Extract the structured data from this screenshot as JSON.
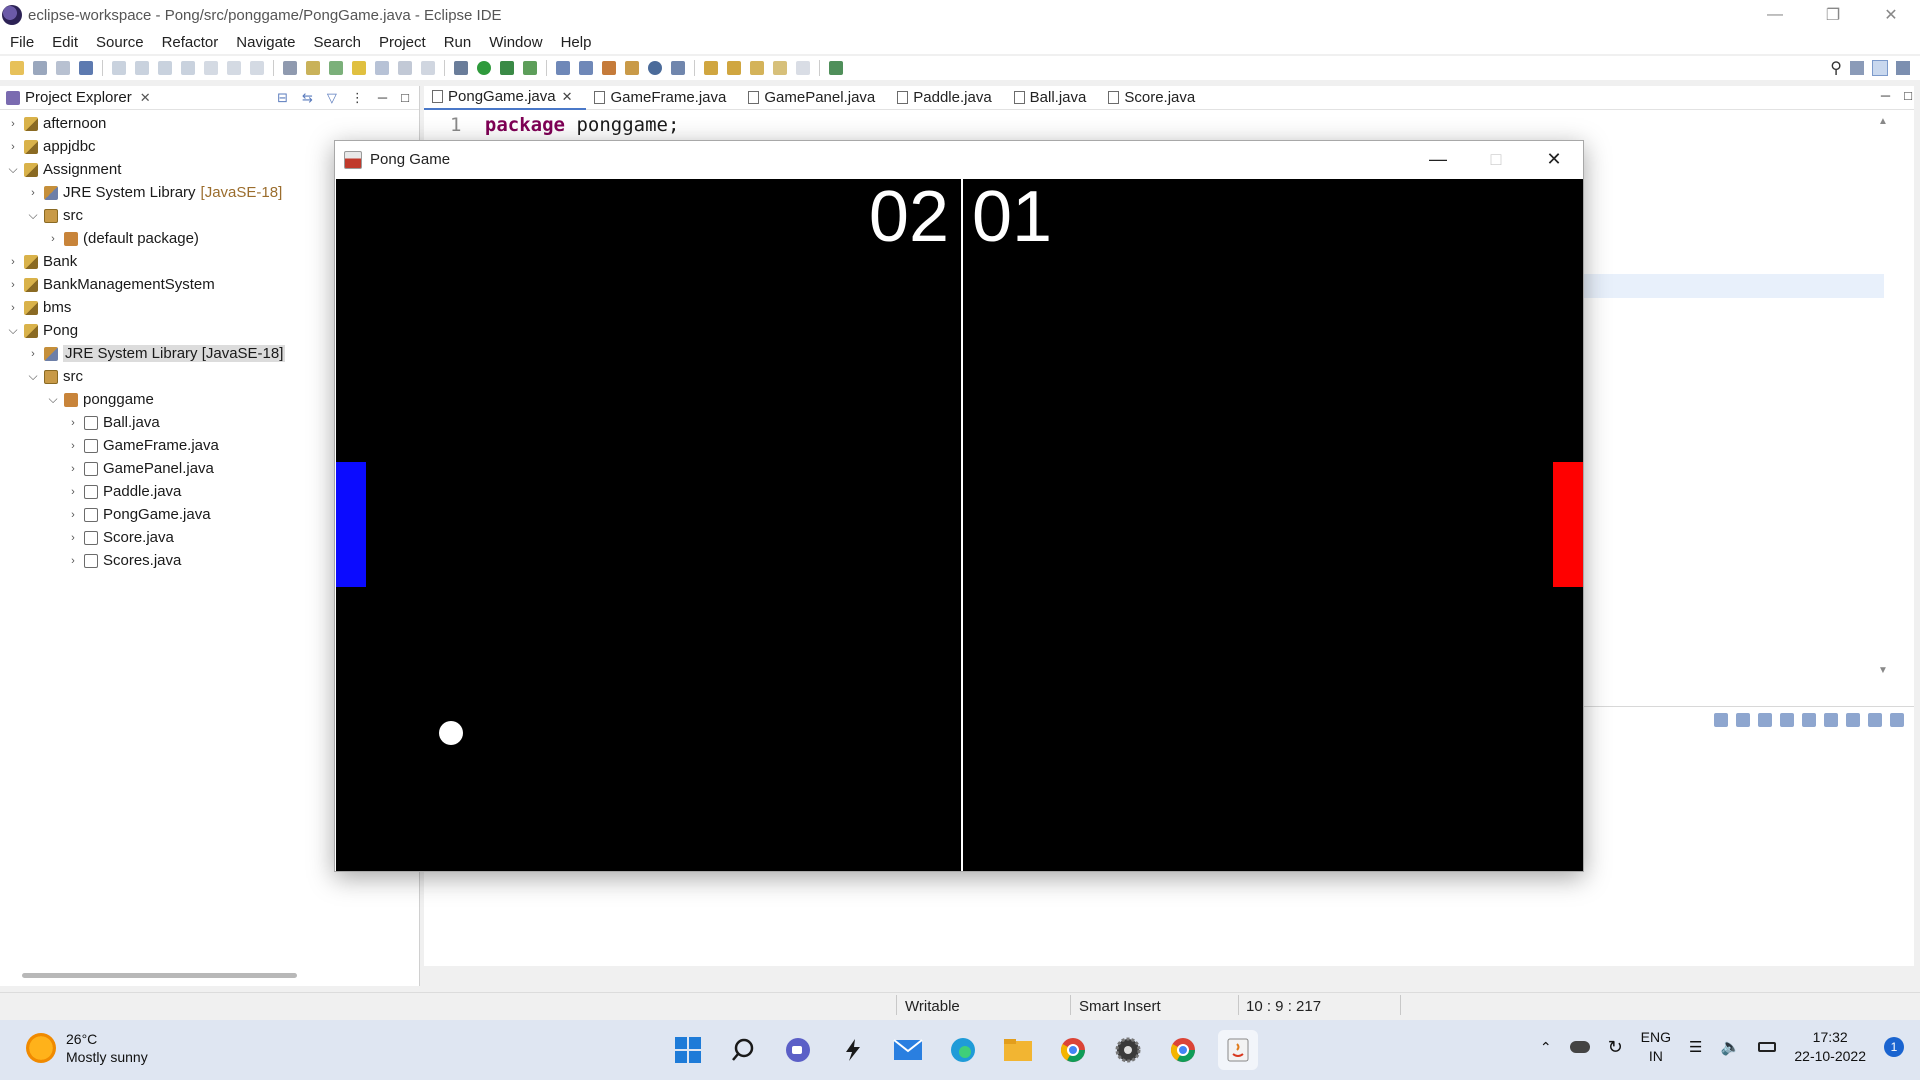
{
  "window": {
    "title": "eclipse-workspace - Pong/src/ponggame/PongGame.java - Eclipse IDE"
  },
  "menu": [
    "File",
    "Edit",
    "Source",
    "Refactor",
    "Navigate",
    "Search",
    "Project",
    "Run",
    "Window",
    "Help"
  ],
  "explorer": {
    "title": "Project Explorer",
    "tree": [
      {
        "label": "afternoon",
        "extra": "",
        "depth": 0,
        "expanded": false,
        "icon": "project-icon"
      },
      {
        "label": "appjdbc",
        "extra": "",
        "depth": 0,
        "expanded": false,
        "icon": "project-icon"
      },
      {
        "label": "Assignment",
        "extra": "",
        "depth": 0,
        "expanded": true,
        "icon": "project-icon"
      },
      {
        "label": "JRE System Library",
        "extra": "[JavaSE-18]",
        "depth": 1,
        "expanded": false,
        "icon": "library-icon"
      },
      {
        "label": "src",
        "extra": "",
        "depth": 1,
        "expanded": true,
        "icon": "source-folder-icon"
      },
      {
        "label": "(default package)",
        "extra": "",
        "depth": 2,
        "expanded": false,
        "icon": "package-icon"
      },
      {
        "label": "Bank",
        "extra": "",
        "depth": 0,
        "expanded": false,
        "icon": "project-icon"
      },
      {
        "label": "BankManagementSystem",
        "extra": "",
        "depth": 0,
        "expanded": false,
        "icon": "project-icon"
      },
      {
        "label": "bms",
        "extra": "",
        "depth": 0,
        "expanded": false,
        "icon": "project-icon"
      },
      {
        "label": "Pong",
        "extra": "",
        "depth": 0,
        "expanded": true,
        "icon": "project-icon"
      },
      {
        "label": "JRE System Library [JavaSE-18]",
        "extra": "",
        "depth": 1,
        "expanded": false,
        "icon": "library-icon",
        "selected": true
      },
      {
        "label": "src",
        "extra": "",
        "depth": 1,
        "expanded": true,
        "icon": "source-folder-icon"
      },
      {
        "label": "ponggame",
        "extra": "",
        "depth": 2,
        "expanded": true,
        "icon": "package-icon"
      },
      {
        "label": "Ball.java",
        "extra": "",
        "depth": 3,
        "expanded": false,
        "icon": "java-file-icon"
      },
      {
        "label": "GameFrame.java",
        "extra": "",
        "depth": 3,
        "expanded": false,
        "icon": "java-file-icon"
      },
      {
        "label": "GamePanel.java",
        "extra": "",
        "depth": 3,
        "expanded": false,
        "icon": "java-file-icon"
      },
      {
        "label": "Paddle.java",
        "extra": "",
        "depth": 3,
        "expanded": false,
        "icon": "java-file-icon"
      },
      {
        "label": "PongGame.java",
        "extra": "",
        "depth": 3,
        "expanded": false,
        "icon": "java-file-icon"
      },
      {
        "label": "Score.java",
        "extra": "",
        "depth": 3,
        "expanded": false,
        "icon": "java-file-icon"
      },
      {
        "label": "Scores.java",
        "extra": "",
        "depth": 3,
        "expanded": false,
        "icon": "java-file-icon"
      }
    ]
  },
  "editor": {
    "tabs": [
      {
        "label": "PongGame.java",
        "active": true
      },
      {
        "label": "GameFrame.java",
        "active": false
      },
      {
        "label": "GamePanel.java",
        "active": false
      },
      {
        "label": "Paddle.java",
        "active": false
      },
      {
        "label": "Ball.java",
        "active": false
      },
      {
        "label": "Score.java",
        "active": false
      }
    ],
    "line_number": "1",
    "keyword": "package",
    "code_rest": "ponggame;"
  },
  "status": {
    "writable": "Writable",
    "insert_mode": "Smart Insert",
    "position": "10 : 9 : 217"
  },
  "pong": {
    "title": "Pong Game",
    "score_left": "02",
    "score_right": "01",
    "colors": {
      "left_paddle": "#0b0bff",
      "right_paddle": "#ff0000",
      "court": "#000000"
    }
  },
  "taskbar": {
    "temperature": "26°C",
    "weather": "Mostly sunny",
    "lang_line1": "ENG",
    "lang_line2": "IN",
    "time": "17:32",
    "date": "22-10-2022",
    "notifications": "1"
  }
}
